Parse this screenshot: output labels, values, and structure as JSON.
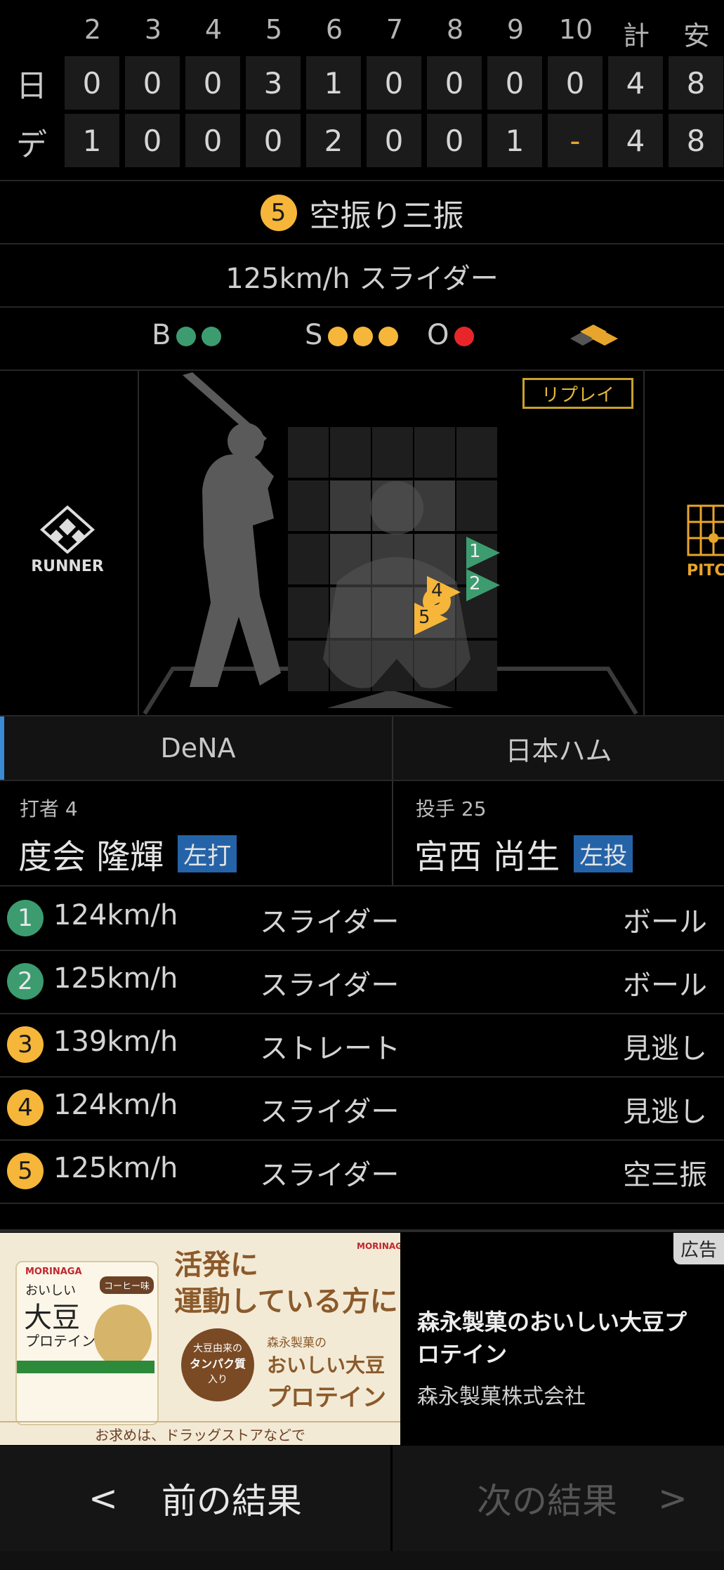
{
  "scoreboard": {
    "innings": [
      "2",
      "3",
      "4",
      "5",
      "6",
      "7",
      "8",
      "9",
      "10"
    ],
    "total_label": "計",
    "hits_label": "安",
    "teams": [
      {
        "abbr": "日",
        "scores": [
          "0",
          "0",
          "0",
          "3",
          "1",
          "0",
          "0",
          "0",
          "0"
        ],
        "total": "4",
        "hits": "8"
      },
      {
        "abbr": "デ",
        "scores": [
          "1",
          "0",
          "0",
          "0",
          "2",
          "0",
          "0",
          "1",
          "-"
        ],
        "total": "4",
        "hits": "8"
      }
    ]
  },
  "play": {
    "pitch_number": "5",
    "result": "空振り三振",
    "pitch_desc": "125km/h スライダー"
  },
  "count": {
    "ball_label": "B",
    "strike_label": "S",
    "out_label": "O",
    "balls": 2,
    "strikes": 3,
    "outs": 1
  },
  "field": {
    "replay_label": "リプレイ",
    "runner_label": "RUNNER",
    "pitcher_label": "PITC"
  },
  "tabs": {
    "home": "DeNA",
    "away": "日本ハム"
  },
  "batter": {
    "role": "打者 4",
    "name": "度会 隆輝",
    "hand": "左打"
  },
  "pitcher": {
    "role": "投手 25",
    "name": "宮西 尚生",
    "hand": "左投"
  },
  "pitches": [
    {
      "num": "1",
      "speed": "124km/h",
      "type": "スライダー",
      "result": "ボール",
      "kind": "ball"
    },
    {
      "num": "2",
      "speed": "125km/h",
      "type": "スライダー",
      "result": "ボール",
      "kind": "ball"
    },
    {
      "num": "3",
      "speed": "139km/h",
      "type": "ストレート",
      "result": "見逃し",
      "kind": "strike"
    },
    {
      "num": "4",
      "speed": "124km/h",
      "type": "スライダー",
      "result": "見逃し",
      "kind": "strike"
    },
    {
      "num": "5",
      "speed": "125km/h",
      "type": "スライダー",
      "result": "空三振",
      "kind": "strike"
    }
  ],
  "ad": {
    "badge": "広告",
    "title": "森永製菓のおいしい大豆プロテイン",
    "company": "森永製菓株式会社",
    "image": {
      "brand": "MORINAGA",
      "headline1": "活発に",
      "headline2": "運動している方に",
      "pack_line1": "おいしい",
      "pack_line2": "大豆",
      "pack_line3": "プロテイン",
      "flavor": "コーヒー味",
      "badge_line1": "大豆由来の",
      "badge_line2": "タンパク質",
      "badge_line3": "入り",
      "right_line1": "森永製菓の",
      "right_line2": "おいしい大豆",
      "right_line3": "プロテイン",
      "footer": "お求めは、ドラッグストアなどで"
    }
  },
  "nav": {
    "prev_arrow": "<",
    "prev_label": "前の結果",
    "next_label": "次の結果",
    "next_arrow": ">"
  },
  "colors": {
    "ball": "#3c9c70",
    "strike": "#f5b63a",
    "out": "#e8262a",
    "hand_badge": "#2563a8"
  }
}
